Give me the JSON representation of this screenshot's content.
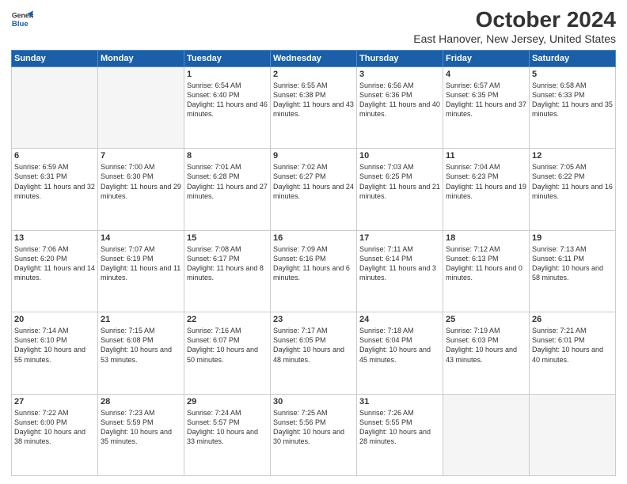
{
  "header": {
    "logo_line1": "General",
    "logo_line2": "Blue",
    "title": "October 2024",
    "subtitle": "East Hanover, New Jersey, United States"
  },
  "days_of_week": [
    "Sunday",
    "Monday",
    "Tuesday",
    "Wednesday",
    "Thursday",
    "Friday",
    "Saturday"
  ],
  "weeks": [
    [
      {
        "day": "",
        "empty": true
      },
      {
        "day": "",
        "empty": true
      },
      {
        "day": "1",
        "sunrise": "6:54 AM",
        "sunset": "6:40 PM",
        "daylight": "11 hours and 46 minutes."
      },
      {
        "day": "2",
        "sunrise": "6:55 AM",
        "sunset": "6:38 PM",
        "daylight": "11 hours and 43 minutes."
      },
      {
        "day": "3",
        "sunrise": "6:56 AM",
        "sunset": "6:36 PM",
        "daylight": "11 hours and 40 minutes."
      },
      {
        "day": "4",
        "sunrise": "6:57 AM",
        "sunset": "6:35 PM",
        "daylight": "11 hours and 37 minutes."
      },
      {
        "day": "5",
        "sunrise": "6:58 AM",
        "sunset": "6:33 PM",
        "daylight": "11 hours and 35 minutes."
      }
    ],
    [
      {
        "day": "6",
        "sunrise": "6:59 AM",
        "sunset": "6:31 PM",
        "daylight": "11 hours and 32 minutes."
      },
      {
        "day": "7",
        "sunrise": "7:00 AM",
        "sunset": "6:30 PM",
        "daylight": "11 hours and 29 minutes."
      },
      {
        "day": "8",
        "sunrise": "7:01 AM",
        "sunset": "6:28 PM",
        "daylight": "11 hours and 27 minutes."
      },
      {
        "day": "9",
        "sunrise": "7:02 AM",
        "sunset": "6:27 PM",
        "daylight": "11 hours and 24 minutes."
      },
      {
        "day": "10",
        "sunrise": "7:03 AM",
        "sunset": "6:25 PM",
        "daylight": "11 hours and 21 minutes."
      },
      {
        "day": "11",
        "sunrise": "7:04 AM",
        "sunset": "6:23 PM",
        "daylight": "11 hours and 19 minutes."
      },
      {
        "day": "12",
        "sunrise": "7:05 AM",
        "sunset": "6:22 PM",
        "daylight": "11 hours and 16 minutes."
      }
    ],
    [
      {
        "day": "13",
        "sunrise": "7:06 AM",
        "sunset": "6:20 PM",
        "daylight": "11 hours and 14 minutes."
      },
      {
        "day": "14",
        "sunrise": "7:07 AM",
        "sunset": "6:19 PM",
        "daylight": "11 hours and 11 minutes."
      },
      {
        "day": "15",
        "sunrise": "7:08 AM",
        "sunset": "6:17 PM",
        "daylight": "11 hours and 8 minutes."
      },
      {
        "day": "16",
        "sunrise": "7:09 AM",
        "sunset": "6:16 PM",
        "daylight": "11 hours and 6 minutes."
      },
      {
        "day": "17",
        "sunrise": "7:11 AM",
        "sunset": "6:14 PM",
        "daylight": "11 hours and 3 minutes."
      },
      {
        "day": "18",
        "sunrise": "7:12 AM",
        "sunset": "6:13 PM",
        "daylight": "11 hours and 0 minutes."
      },
      {
        "day": "19",
        "sunrise": "7:13 AM",
        "sunset": "6:11 PM",
        "daylight": "10 hours and 58 minutes."
      }
    ],
    [
      {
        "day": "20",
        "sunrise": "7:14 AM",
        "sunset": "6:10 PM",
        "daylight": "10 hours and 55 minutes."
      },
      {
        "day": "21",
        "sunrise": "7:15 AM",
        "sunset": "6:08 PM",
        "daylight": "10 hours and 53 minutes."
      },
      {
        "day": "22",
        "sunrise": "7:16 AM",
        "sunset": "6:07 PM",
        "daylight": "10 hours and 50 minutes."
      },
      {
        "day": "23",
        "sunrise": "7:17 AM",
        "sunset": "6:05 PM",
        "daylight": "10 hours and 48 minutes."
      },
      {
        "day": "24",
        "sunrise": "7:18 AM",
        "sunset": "6:04 PM",
        "daylight": "10 hours and 45 minutes."
      },
      {
        "day": "25",
        "sunrise": "7:19 AM",
        "sunset": "6:03 PM",
        "daylight": "10 hours and 43 minutes."
      },
      {
        "day": "26",
        "sunrise": "7:21 AM",
        "sunset": "6:01 PM",
        "daylight": "10 hours and 40 minutes."
      }
    ],
    [
      {
        "day": "27",
        "sunrise": "7:22 AM",
        "sunset": "6:00 PM",
        "daylight": "10 hours and 38 minutes."
      },
      {
        "day": "28",
        "sunrise": "7:23 AM",
        "sunset": "5:59 PM",
        "daylight": "10 hours and 35 minutes."
      },
      {
        "day": "29",
        "sunrise": "7:24 AM",
        "sunset": "5:57 PM",
        "daylight": "10 hours and 33 minutes."
      },
      {
        "day": "30",
        "sunrise": "7:25 AM",
        "sunset": "5:56 PM",
        "daylight": "10 hours and 30 minutes."
      },
      {
        "day": "31",
        "sunrise": "7:26 AM",
        "sunset": "5:55 PM",
        "daylight": "10 hours and 28 minutes."
      },
      {
        "day": "",
        "empty": true
      },
      {
        "day": "",
        "empty": true
      }
    ]
  ]
}
